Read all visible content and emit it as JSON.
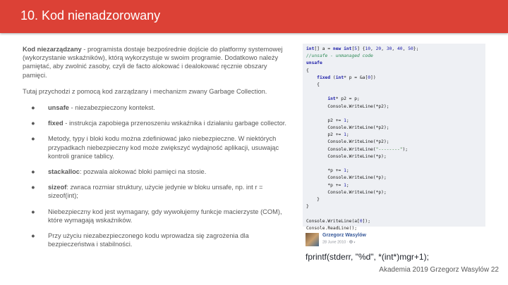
{
  "title": "10. Kod nienadzorowany",
  "intro": {
    "term": "Kod niezarządzany",
    "text": " - programista dostaje bezpośrednie dojście do platformy systemowej (wykorzystanie wskaźników), którą wykorzystuje w swoim programie. Dodatkowo należy pamiętać, aby zwolnić zasoby, czyli de facto alokować i dealokować ręcznie obszary pamięci."
  },
  "subtitle": "Tutaj przychodzi z pomocą kod zarządzany i mechanizm zwany Garbage Collection.",
  "bullet_symbol": "●",
  "bullets": [
    {
      "term": "unsafe",
      "text": " - niezabezpieczony kontekst."
    },
    {
      "term": "fixed",
      "text": " - instrukcja zapobiega przenoszeniu wskaźnika i działaniu garbage collector."
    },
    {
      "term": "",
      "text": "Metody, typy i bloki kodu można zdefiniować jako niebezpieczne. W niektórych przypadkach niebezpieczny kod może zwiększyć wydajność aplikacji, usuwając kontroli granice tablicy."
    },
    {
      "term": "stackalloc",
      "text": ": pozwala alokować bloki pamięci na stosie."
    },
    {
      "term": "sizeof",
      "text": ": zwraca rozmiar struktury, użycie jedynie w bloku unsafe, np. int r = sizeof(int);"
    },
    {
      "term": "",
      "text": "Niebezpieczny kod jest wymagany, gdy wywołujemy funkcje macierzyste (COM), które wymagają wskaźników."
    },
    {
      "term": "",
      "text": "Przy użyciu niezabezpieczonego kodu wprowadza się zagrożenia dla bezpieczeństwa i stabilności."
    }
  ],
  "code_lines": [
    "int[] a = new int[5] {10, 20, 30, 40, 50};",
    "//unsafe - unmanaged code",
    "unsafe",
    "{",
    "    fixed (int* p = &a[0])",
    "    {",
    "",
    "        int* p2 = p;",
    "        Console.WriteLine(*p2);",
    "",
    "        p2 += 1;",
    "        Console.WriteLine(*p2);",
    "        p2 += 1;",
    "        Console.WriteLine(*p2);",
    "        Console.WriteLine(\"--------\");",
    "        Console.WriteLine(*p);",
    "",
    "        *p += 1;",
    "        Console.WriteLine(*p);",
    "        *p += 1;",
    "        Console.WriteLine(*p);",
    "    }",
    "}",
    "",
    "Console.WriteLine(a[0]);",
    "Console.ReadLine();"
  ],
  "post": {
    "author": "Grzegorz Wasylów",
    "date": "28 June 2010 · ",
    "audience_icon": "globe-icon",
    "text": "fprintf(stderr, \"%d\", *(int*)mgr+1);"
  },
  "footer": "Akademia 2019 Grzegorz Wasylów 22",
  "colors": {
    "header": "#dc4136",
    "code_bg": "#eef0f4",
    "keyword": "#1c1ca8",
    "comment": "#2e8b57",
    "body_text": "#595959"
  }
}
